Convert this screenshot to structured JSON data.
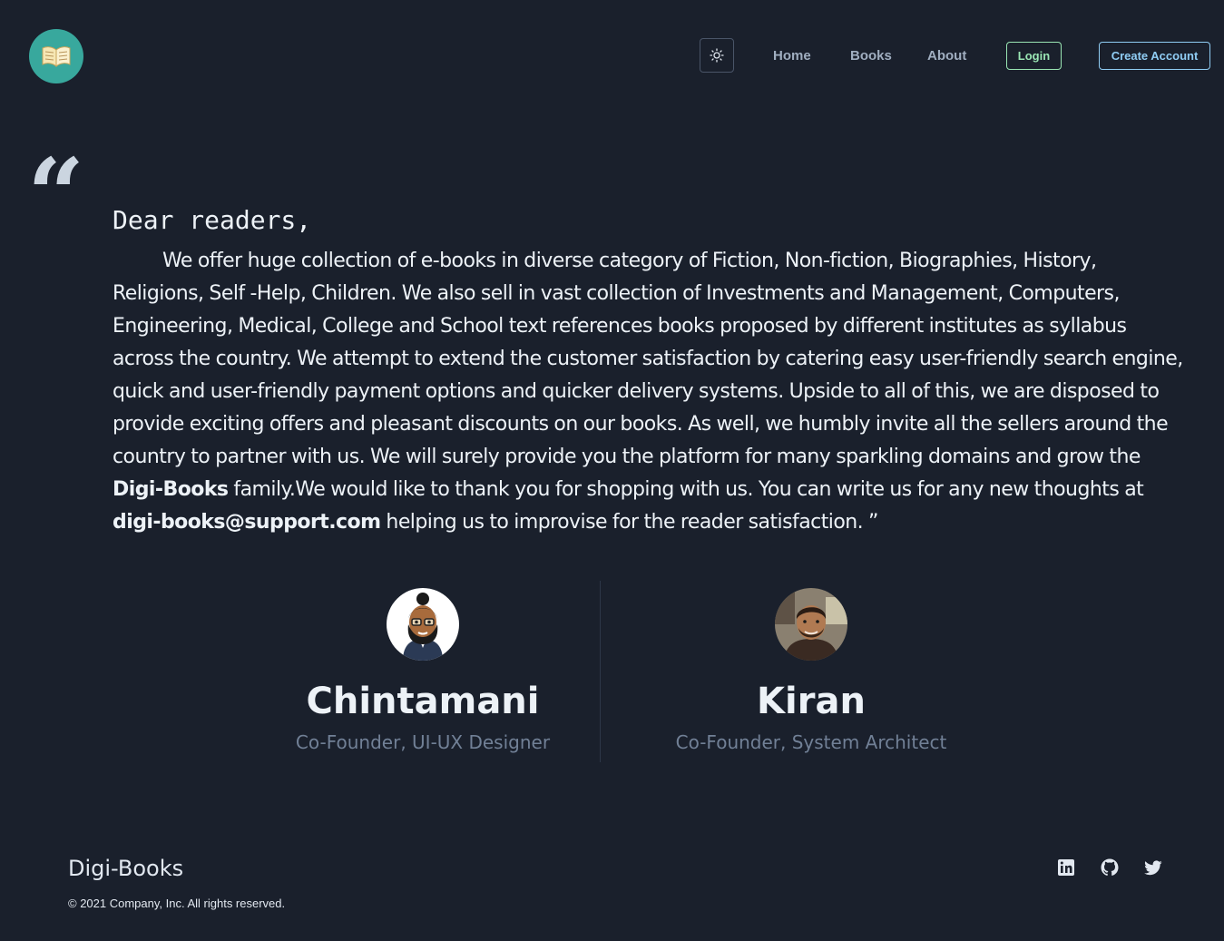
{
  "header": {
    "theme_icon": "sun-icon",
    "nav": [
      {
        "label": "Home"
      },
      {
        "label": "Books"
      },
      {
        "label": "About"
      }
    ],
    "login_label": "Login",
    "create_account_label": "Create Account"
  },
  "letter": {
    "greeting": "Dear readers,",
    "body_part1": "We offer huge collection of e-books in diverse category of Fiction, Non-fiction, Biographies, History, Religions, Self -Help, Children. We also sell in vast collection of Investments and Management, Computers, Engineering, Medical, College and School text references books proposed by different institutes as syllabus across the country. We attempt to extend the customer satisfaction by catering easy user-friendly search engine, quick and user-friendly payment options and quicker delivery systems. Upside to all of this, we are disposed to provide exciting offers and pleasant discounts on our books. As well, we humbly invite all the sellers around the country to partner with us. We will surely provide you the platform for many sparkling domains and grow the ",
    "brand": "Digi-Books",
    "body_part2": " family.We would like to thank you for shopping with us. You can write us for any new thoughts at ",
    "email": "digi-books@support.com",
    "body_part3": " helping us to improvise for the reader satisfaction. ”"
  },
  "team": [
    {
      "name": "Chintamani",
      "role": "Co-Founder, UI-UX Designer"
    },
    {
      "name": "Kiran",
      "role": "Co-Founder, System Architect"
    }
  ],
  "footer": {
    "brand": "Digi-Books",
    "copyright": "© 2021 Company, Inc. All rights reserved.",
    "social": [
      "linkedin-icon",
      "github-icon",
      "twitter-icon"
    ]
  },
  "colors": {
    "background": "#1a202c",
    "logo": "#38a89d",
    "login": "#9ae6b4",
    "create_account": "#90cdf4"
  }
}
